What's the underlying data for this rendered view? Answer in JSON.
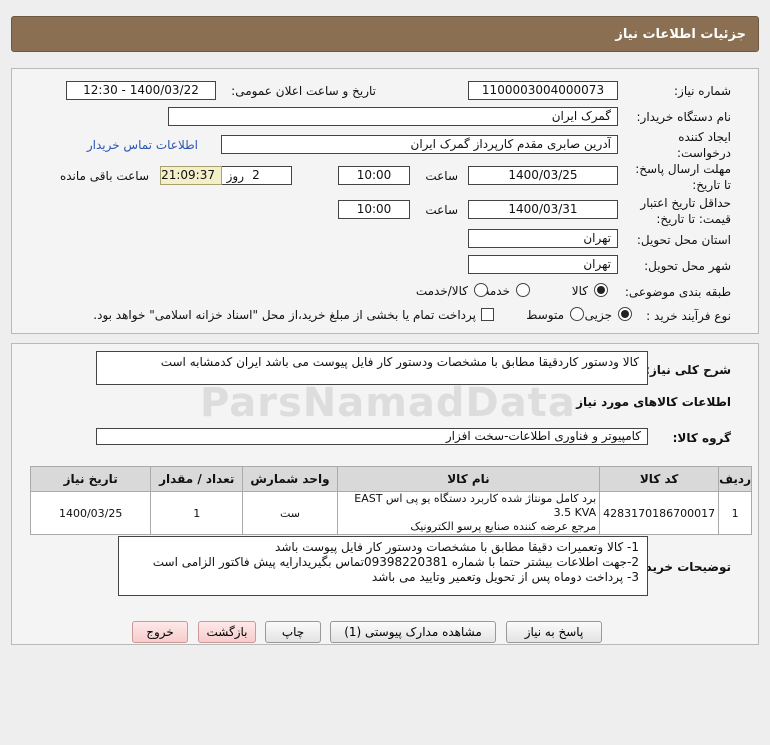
{
  "header": {
    "title": "جزئیات اطلاعات نیاز"
  },
  "form": {
    "need_number_label": "شماره نیاز:",
    "need_number": "1100003004000073",
    "announce_label": "تاریخ و ساعت اعلان عمومی:",
    "announce_value": "1400/03/22 - 12:30",
    "buyer_label": "نام دستگاه خریدار:",
    "buyer": "گمرک ایران",
    "creator_label_1": "ایجاد کننده",
    "creator_label_2": "درخواست:",
    "creator": "آدرین صابری مقدم کارپرداز گمرک ایران",
    "contact_link": "اطلاعات تماس خریدار",
    "deadline_label_1": "مهلت ارسال پاسخ:",
    "deadline_label_2": "تا تاریخ:",
    "deadline_date": "1400/03/25",
    "time_label": "ساعت",
    "deadline_time": "10:00",
    "days_value": "2",
    "days_label": "روز و",
    "timer": "21:09:37",
    "remaining_label": "ساعت باقی مانده",
    "validity_label_1": "حداقل تاریخ اعتبار",
    "validity_label_2": "قیمت: تا تاریخ:",
    "validity_date": "1400/03/31",
    "validity_time": "10:00",
    "province_label": "استان محل تحویل:",
    "province": "تهران",
    "city_label": "شهر محل تحویل:",
    "city": "تهران",
    "category_label": "طبقه بندی موضوعی:",
    "category_options": [
      "کالا",
      "خدمت",
      "کالا/خدمت"
    ],
    "process_label": "نوع فرآیند خرید :",
    "process_options": [
      "جزیی",
      "متوسط"
    ],
    "payment_note": "پرداخت تمام یا بخشی از مبلغ خرید،از محل \"اسناد خزانه اسلامی\" خواهد بود."
  },
  "details": {
    "summary_label": "شرح کلی نیاز:",
    "summary": "کالا ودستور کاردقیقا مطابق با مشخصات ودستور کار فایل پیوست می باشد ایران کدمشابه است",
    "goods_info_title": "اطلاعات کالاهای مورد نیاز",
    "goods_group_label": "گروه کالا:",
    "goods_group": "کامپیوتر و فناوری اطلاعات-سخت افزار",
    "table": {
      "headers": [
        "ردیف",
        "کد کالا",
        "نام کالا",
        "واحد شمارش",
        "تعداد / مقدار",
        "تاریخ نیاز"
      ],
      "rows": [
        {
          "row": "1",
          "code": "4283170186700017",
          "name_line1": "برد کامل مونتاژ شده کاربرد دستگاه یو پی اس EAST 3.5 KVA",
          "name_line2": "مرجع عرضه کننده صنایع پرسو الکترونیک",
          "unit": "ست",
          "qty": "1",
          "date": "1400/03/25"
        }
      ]
    },
    "buyer_notes_label": "توضیحات خریدار:",
    "buyer_notes": [
      "1- کالا وتعمیرات دقیقا مطابق با مشخصات ودستور کار فایل پیوست باشد",
      "2-جهت اطلاعات بیشتر حتما با شماره 09398220381تماس بگیریدارایه پیش فاکتور الزامی است",
      "3- پرداخت دوماه پس از تحویل وتعمیر وتایید می باشد"
    ]
  },
  "watermark": "ParsNamadData",
  "buttons": {
    "reply": "پاسخ به نیاز",
    "attachments": "مشاهده مدارک پیوستی (1)",
    "print": "چاپ",
    "back": "بازگشت",
    "exit": "خروج"
  }
}
